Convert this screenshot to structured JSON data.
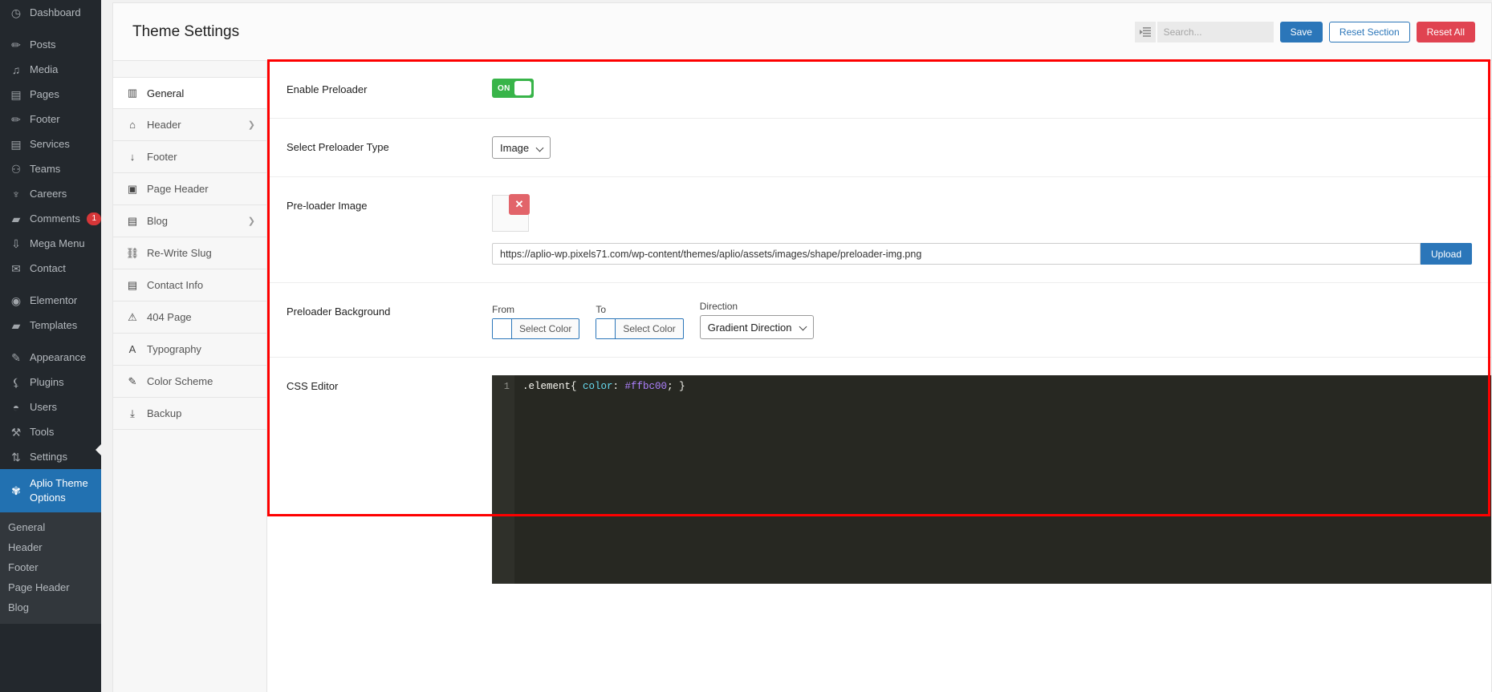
{
  "wp_sidebar": {
    "items": [
      {
        "label": "Dashboard",
        "icon": "dashboard-icon",
        "glyph": "◷",
        "badge": null,
        "gap": false
      },
      {
        "label": "Posts",
        "icon": "pin-icon",
        "glyph": "✏",
        "badge": null,
        "gap": true
      },
      {
        "label": "Media",
        "icon": "media-icon",
        "glyph": "♫",
        "badge": null,
        "gap": false
      },
      {
        "label": "Pages",
        "icon": "page-icon",
        "glyph": "▤",
        "badge": null,
        "gap": false
      },
      {
        "label": "Footer",
        "icon": "pin-icon",
        "glyph": "✏",
        "badge": null,
        "gap": false
      },
      {
        "label": "Services",
        "icon": "list-icon",
        "glyph": "▤",
        "badge": null,
        "gap": false
      },
      {
        "label": "Teams",
        "icon": "users-icon",
        "glyph": "⚇",
        "badge": null,
        "gap": false
      },
      {
        "label": "Careers",
        "icon": "lightbulb-icon",
        "glyph": "♆",
        "badge": null,
        "gap": false
      },
      {
        "label": "Comments",
        "icon": "comment-icon",
        "glyph": "▰",
        "badge": "1",
        "gap": false
      },
      {
        "label": "Mega Menu",
        "icon": "download-icon",
        "glyph": "⇩",
        "badge": null,
        "gap": false
      },
      {
        "label": "Contact",
        "icon": "mail-icon",
        "glyph": "✉",
        "badge": null,
        "gap": false
      },
      {
        "label": "Elementor",
        "icon": "elementor-icon",
        "glyph": "◉",
        "badge": null,
        "gap": true
      },
      {
        "label": "Templates",
        "icon": "folder-icon",
        "glyph": "▰",
        "badge": null,
        "gap": false
      },
      {
        "label": "Appearance",
        "icon": "brush-icon",
        "glyph": "✎",
        "badge": null,
        "gap": true
      },
      {
        "label": "Plugins",
        "icon": "plug-icon",
        "glyph": "⚸",
        "badge": null,
        "gap": false
      },
      {
        "label": "Users",
        "icon": "user-icon",
        "glyph": "◓",
        "badge": null,
        "gap": false
      },
      {
        "label": "Tools",
        "icon": "wrench-icon",
        "glyph": "⚒",
        "badge": null,
        "gap": false
      },
      {
        "label": "Settings",
        "icon": "sliders-icon",
        "glyph": "⇅",
        "badge": null,
        "gap": false
      }
    ],
    "current": {
      "label": "Aplio Theme Options",
      "icon": "gear-icon",
      "glyph": "✾"
    },
    "submenu": [
      {
        "label": "General"
      },
      {
        "label": "Header"
      },
      {
        "label": "Footer"
      },
      {
        "label": "Page Header"
      },
      {
        "label": "Blog"
      }
    ]
  },
  "header": {
    "title": "Theme Settings",
    "collapse_icon": "collapse-sidebar-icon",
    "search_placeholder": "Search...",
    "search_value": "",
    "save_label": "Save",
    "reset_section_label": "Reset Section",
    "reset_all_label": "Reset All"
  },
  "tabs": [
    {
      "label": "General",
      "icon": "building-icon",
      "glyph": "▥",
      "active": true,
      "chevron": false
    },
    {
      "label": "Header",
      "icon": "home-icon",
      "glyph": "⌂",
      "active": false,
      "chevron": true
    },
    {
      "label": "Footer",
      "icon": "arrow-down-icon",
      "glyph": "↓",
      "active": false,
      "chevron": false
    },
    {
      "label": "Page Header",
      "icon": "image-icon",
      "glyph": "▣",
      "active": false,
      "chevron": false
    },
    {
      "label": "Blog",
      "icon": "document-icon",
      "glyph": "▤",
      "active": false,
      "chevron": true
    },
    {
      "label": "Re-Write Slug",
      "icon": "link-icon",
      "glyph": "⛓",
      "active": false,
      "chevron": false
    },
    {
      "label": "Contact Info",
      "icon": "contact-card-icon",
      "glyph": "▤",
      "active": false,
      "chevron": false
    },
    {
      "label": "404 Page",
      "icon": "warning-icon",
      "glyph": "⚠",
      "active": false,
      "chevron": false
    },
    {
      "label": "Typography",
      "icon": "letter-a-icon",
      "glyph": "A",
      "active": false,
      "chevron": false
    },
    {
      "label": "Color Scheme",
      "icon": "paintbrush-icon",
      "glyph": "✎",
      "active": false,
      "chevron": false
    },
    {
      "label": "Backup",
      "icon": "download-icon",
      "glyph": "⤓",
      "active": false,
      "chevron": false
    }
  ],
  "fields": {
    "enable_preloader": {
      "label": "Enable Preloader",
      "toggle_state": "ON"
    },
    "preloader_type": {
      "label": "Select Preloader Type",
      "value": "Image"
    },
    "preloader_image": {
      "label": "Pre-loader Image",
      "remove_icon": "remove-image-icon",
      "url": "https://aplio-wp.pixels71.com/wp-content/themes/aplio/assets/images/shape/preloader-img.png",
      "upload_label": "Upload"
    },
    "preloader_background": {
      "label": "Preloader Background",
      "from_label": "From",
      "from_value": "Select Color",
      "to_label": "To",
      "to_value": "Select Color",
      "direction_label": "Direction",
      "direction_value": "Gradient Direction"
    },
    "css_editor": {
      "label": "CSS Editor",
      "line_number": "1",
      "code_selector": ".element{ ",
      "code_property": "color",
      "code_colon": ": ",
      "code_value": "#ffbc00",
      "code_tail": "; }"
    }
  },
  "colors": {
    "accent_blue": "#2b76b9",
    "danger_red": "#e04351",
    "toggle_green": "#38b449",
    "highlight_red": "#fe0000",
    "css_value": "#ffbc00"
  }
}
